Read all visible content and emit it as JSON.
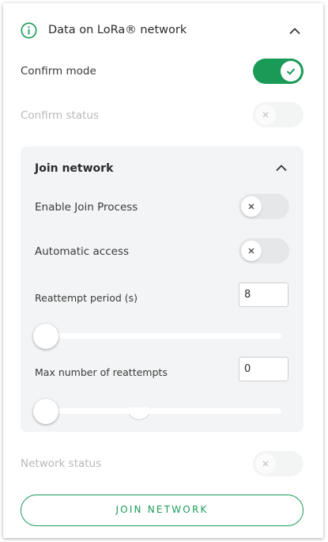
{
  "header": {
    "title": "Data on LoRa® network",
    "icon": "info-icon",
    "collapse_icon": "chevron-up-icon"
  },
  "confirm_mode": {
    "label": "Confirm mode",
    "state": "on"
  },
  "confirm_status": {
    "label": "Confirm status",
    "state": "off-disabled"
  },
  "join_panel": {
    "title": "Join network",
    "collapse_icon": "chevron-up-icon",
    "enable_join": {
      "label": "Enable Join Process",
      "state": "off"
    },
    "automatic_access": {
      "label": "Automatic access",
      "state": "off"
    },
    "reattempt_period": {
      "label": "Reattempt period (s)",
      "value": "8",
      "slider_fraction": 0
    },
    "max_reattempts": {
      "label": "Max number of reattempts",
      "value": "0",
      "slider_fraction": 0
    }
  },
  "network_status": {
    "label": "Network status",
    "state": "off-disabled"
  },
  "join_button": {
    "label": "JOIN NETWORK"
  },
  "colors": {
    "accent": "#1a9a57",
    "panel_bg": "#f3f4f5",
    "toggle_off": "#e6e7e8",
    "disabled_text": "#b8b8b8"
  }
}
